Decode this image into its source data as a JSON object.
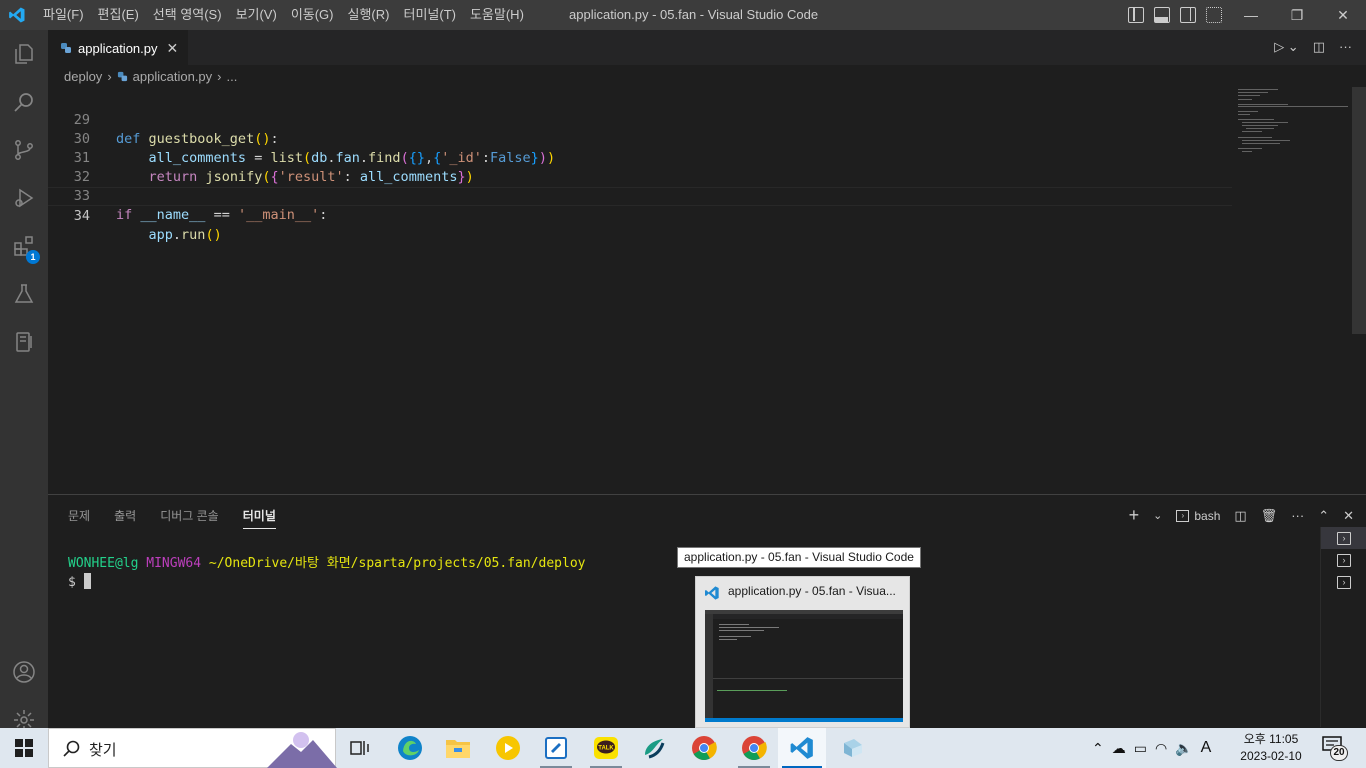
{
  "window": {
    "title": "application.py - 05.fan - Visual Studio Code",
    "menu": [
      "파일(F)",
      "편집(E)",
      "선택 영역(S)",
      "보기(V)",
      "이동(G)",
      "실행(R)",
      "터미널(T)",
      "도움말(H)"
    ]
  },
  "tabs": [
    {
      "label": "application.py",
      "close": "✕"
    }
  ],
  "breadcrumb": {
    "folder": "deploy",
    "file": "application.py",
    "more": "..."
  },
  "code": [
    {
      "num": "29",
      "text": "def guestbook_get():"
    },
    {
      "num": "30",
      "text": "    all_comments = list(db.fan.find({},{'_id':False}))"
    },
    {
      "num": "31",
      "text": "    return jsonify({'result': all_comments})"
    },
    {
      "num": "32",
      "text": ""
    },
    {
      "num": "33",
      "text": "if __name__ == '__main__':"
    },
    {
      "num": "34",
      "text": "    app.run()"
    }
  ],
  "panel": {
    "tabs": [
      "문제",
      "출력",
      "디버그 콘솔",
      "터미널"
    ],
    "active_tab": "터미널",
    "shell": "bash",
    "terminal": {
      "user": "WONHEE@lg",
      "system": "MINGW64",
      "path": "~/OneDrive/바탕 화면/sparta/projects/05.fan/deploy",
      "prompt": "$"
    }
  },
  "activity": {
    "extensions_badge": "1"
  },
  "tooltip": "application.py - 05.fan - Visual Studio Code",
  "thumbnail": {
    "title": "application.py - 05.fan - Visua..."
  },
  "taskbar": {
    "search_placeholder": "찾기",
    "clock_time": "오후 11:05",
    "clock_date": "2023-02-10",
    "notifications": "20",
    "ime": "A"
  },
  "colors": {
    "accent": "#0078d4",
    "editor_bg": "#1e1e1e",
    "titlebar": "#3c3c3c"
  }
}
